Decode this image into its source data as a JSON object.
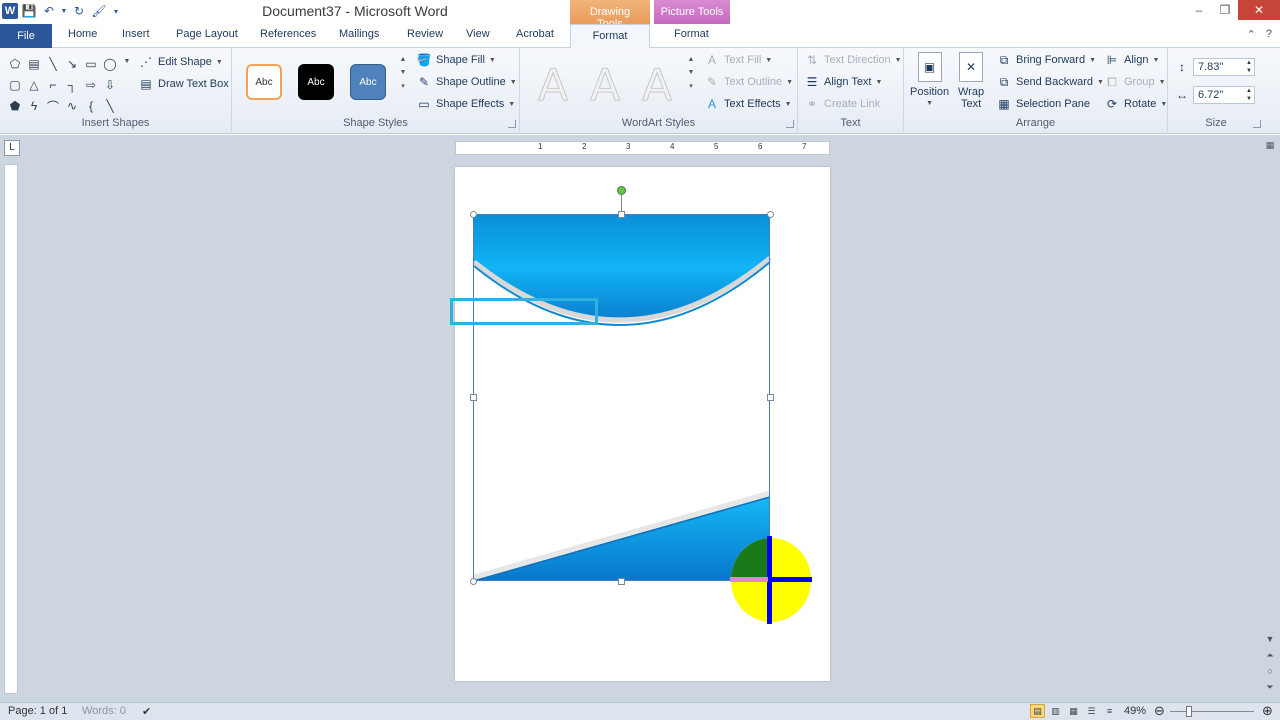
{
  "window": {
    "title": "Document37 - Microsoft Word",
    "context_tabs": {
      "drawing_tools": "Drawing Tools",
      "picture_tools": "Picture Tools"
    }
  },
  "qat": {
    "word_icon": "W"
  },
  "tabs": {
    "file": "File",
    "home": "Home",
    "insert": "Insert",
    "page_layout": "Page Layout",
    "references": "References",
    "mailings": "Mailings",
    "review": "Review",
    "view": "View",
    "acrobat": "Acrobat",
    "format_drawing": "Format",
    "format_picture": "Format"
  },
  "ribbon": {
    "insert_shapes": {
      "label": "Insert Shapes",
      "edit_shape": "Edit Shape",
      "draw_text_box": "Draw Text Box"
    },
    "shape_styles": {
      "label": "Shape Styles",
      "presets": [
        "Abc",
        "Abc",
        "Abc"
      ],
      "shape_fill": "Shape Fill",
      "shape_outline": "Shape Outline",
      "shape_effects": "Shape Effects"
    },
    "wordart_styles": {
      "label": "WordArt Styles",
      "letters": [
        "A",
        "A",
        "A"
      ],
      "text_fill": "Text Fill",
      "text_outline": "Text Outline",
      "text_effects": "Text Effects"
    },
    "text": {
      "label": "Text",
      "text_direction": "Text Direction",
      "align_text": "Align Text",
      "create_link": "Create Link"
    },
    "arrange": {
      "label": "Arrange",
      "position": "Position",
      "wrap_text_1": "Wrap",
      "wrap_text_2": "Text",
      "bring_forward": "Bring Forward",
      "send_backward": "Send Backward",
      "selection_pane": "Selection Pane",
      "align": "Align",
      "group": "Group",
      "rotate": "Rotate"
    },
    "size": {
      "label": "Size",
      "height": "7.83\"",
      "width": "6.72\""
    }
  },
  "ruler": {
    "numbers": [
      "1",
      "2",
      "3",
      "4",
      "5",
      "6",
      "7"
    ]
  },
  "statusbar": {
    "page": "Page: 1 of 1",
    "words": "Words: 0",
    "zoom": "49%"
  },
  "colors": {
    "accent_blue": "#2b579a",
    "shape_blue_top": "#00aaff",
    "shape_blue_bottom": "#0077cc",
    "textbox_border": "#2fb1e0",
    "cursor_yellow": "#ffff00",
    "cursor_green": "#1a7a1a",
    "cursor_blue": "#0000ee"
  }
}
